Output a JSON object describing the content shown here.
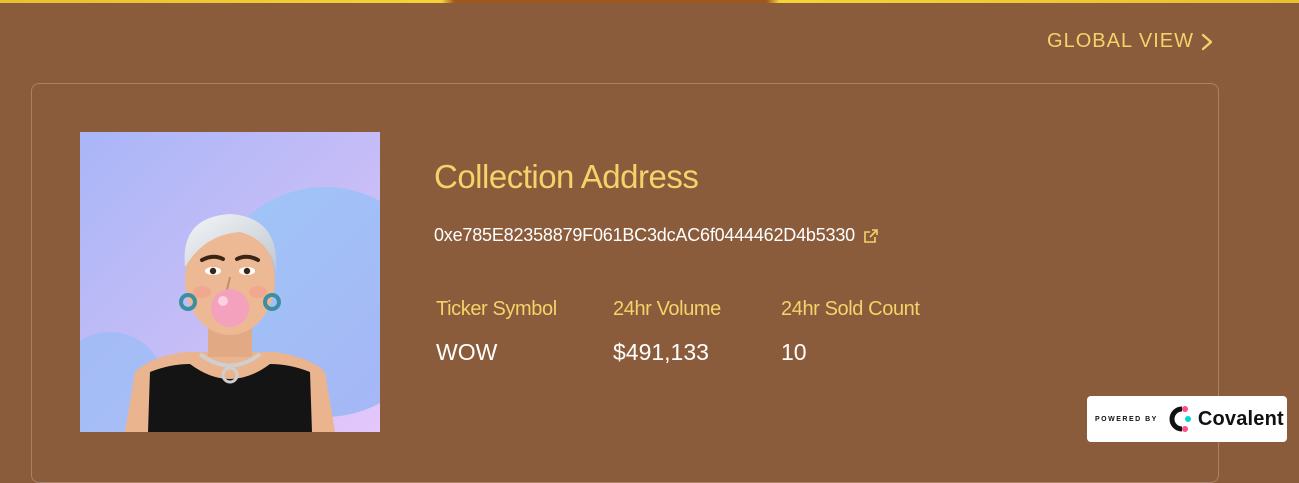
{
  "nav": {
    "global_view_label": "GLOBAL VIEW"
  },
  "collection": {
    "title": "Collection Address",
    "address": "0xe785E82358879F061BC3dcAC6f0444462D4b5330",
    "image_icon": "nft-avatar-image",
    "stats": [
      {
        "label": "Ticker Symbol",
        "value": "WOW"
      },
      {
        "label": "24hr Volume",
        "value": "$491,133"
      },
      {
        "label": "24hr Sold Count",
        "value": "10"
      }
    ]
  },
  "badge": {
    "powered_by": "POWERED BY",
    "brand": "Covalent"
  },
  "colors": {
    "background": "#8B5C3B",
    "accent": "#F3D36A",
    "text": "#FFFFFF"
  }
}
